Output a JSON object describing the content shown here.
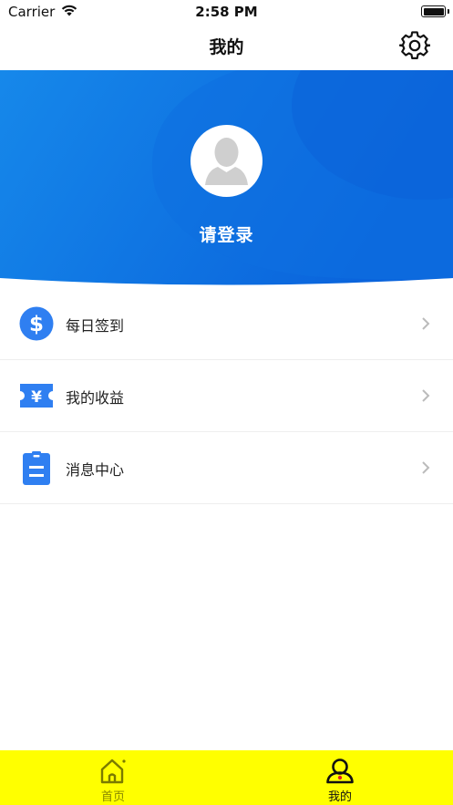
{
  "status_bar": {
    "carrier": "Carrier",
    "time": "2:58 PM",
    "icons": [
      "wifi-icon",
      "battery-icon"
    ]
  },
  "nav": {
    "title": "我的",
    "settings_icon": "gear-icon"
  },
  "header": {
    "avatar_icon": "default-avatar",
    "login_text": "请登录",
    "colors": {
      "gradient_start": "#1a86ea",
      "gradient_end": "#0a66dc",
      "wave": "#1474e2"
    }
  },
  "menu": {
    "items": [
      {
        "label": "每日签到",
        "icon": "dollar-coin-icon"
      },
      {
        "label": "我的收益",
        "icon": "yuan-ticket-icon"
      },
      {
        "label": "消息中心",
        "icon": "clipboard-icon"
      }
    ],
    "icon_color": "#2f7ff1",
    "chevron_icon": "chevron-right-icon"
  },
  "tab_bar": {
    "background": "#ffff00",
    "tabs": [
      {
        "label": "首页",
        "icon": "home-icon",
        "selected": false
      },
      {
        "label": "我的",
        "icon": "user-icon",
        "selected": true
      }
    ]
  }
}
